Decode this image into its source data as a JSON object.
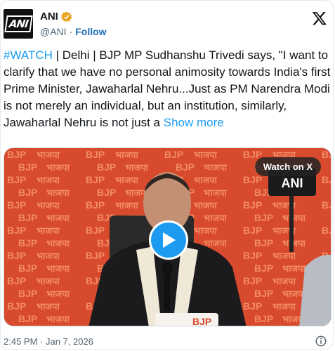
{
  "account": {
    "name": "ANI",
    "handle": "@ANI",
    "separator": "·",
    "follow_label": "Follow",
    "avatar_text": "ANI"
  },
  "tweet": {
    "hashtag": "#WATCH",
    "body": " | Delhi | BJP MP Sudhanshu Trivedi says, \"I want to clarify that we have no personal animosity towards India's first Prime Minister, Jawaharlal Nehru...Just as PM Narendra Modi is not merely an individual, but an institution, similarly, Jawaharlal Nehru is not just a ",
    "show_more": "Show more"
  },
  "media": {
    "watch_label": "Watch on X",
    "backdrop_text": [
      "BJP",
      "भाजपा"
    ],
    "mic_text": "ANI",
    "podium_text": "BJP",
    "colors": {
      "backdrop": "#d84a2d",
      "play": "#1d9bf0"
    }
  },
  "footer": {
    "timestamp": "2:45 PM · Jan 7, 2026"
  },
  "icons": [
    "verified-badge-icon",
    "x-logo-icon",
    "play-icon",
    "info-icon"
  ]
}
